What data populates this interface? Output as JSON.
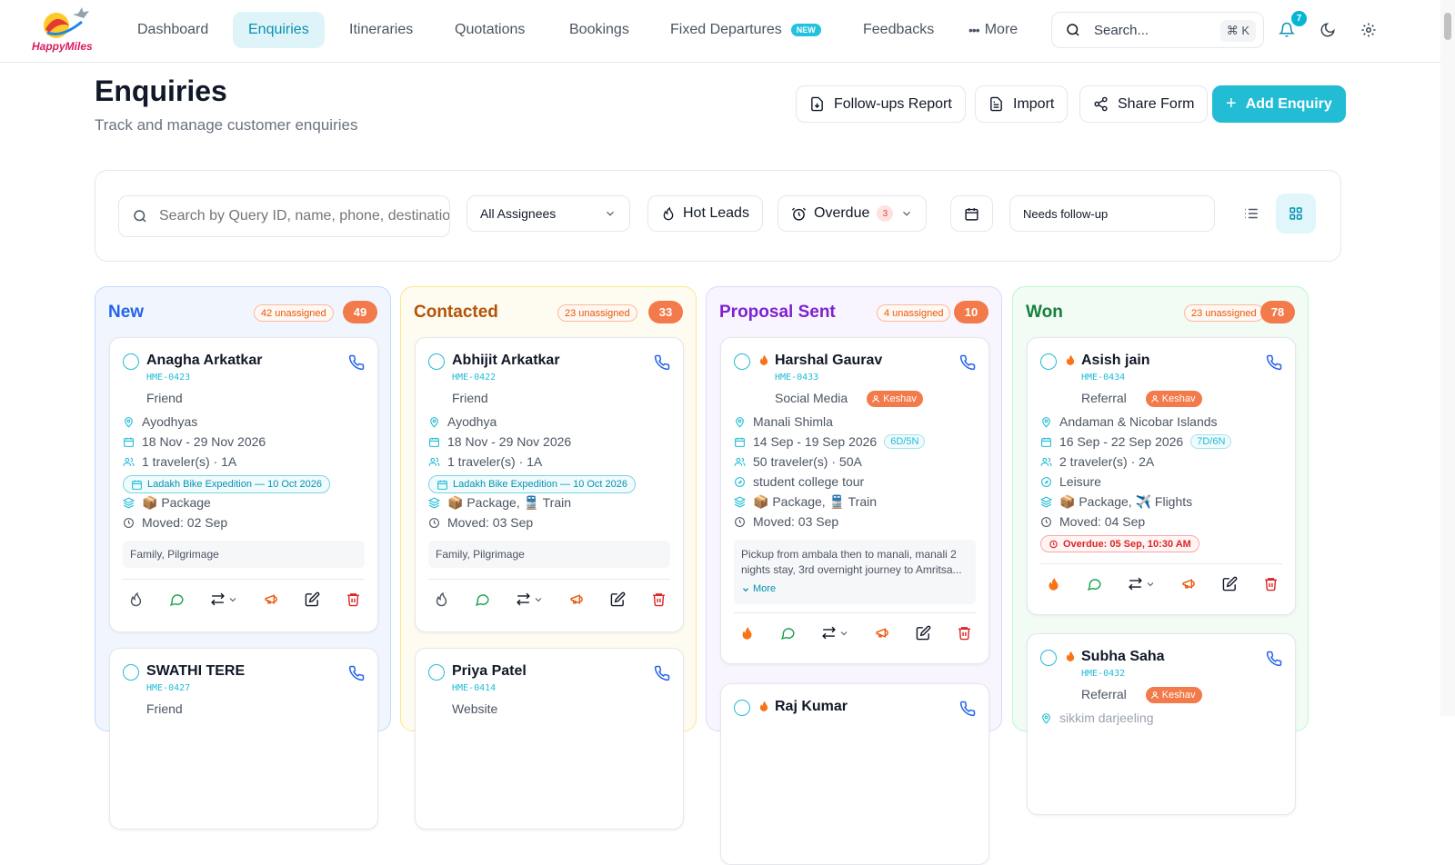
{
  "brand": {
    "name": "HappyMiles"
  },
  "nav": {
    "items": [
      {
        "label": "Dashboard"
      },
      {
        "label": "Enquiries",
        "active": true
      },
      {
        "label": "Itineraries"
      },
      {
        "label": "Quotations"
      },
      {
        "label": "Bookings"
      },
      {
        "label": "Fixed Departures",
        "badge": "NEW"
      },
      {
        "label": "Feedbacks"
      },
      {
        "label": "More"
      }
    ]
  },
  "search": {
    "label": "Search...",
    "shortcut": "⌘ K"
  },
  "notifications": {
    "count": "7"
  },
  "page": {
    "title": "Enquiries",
    "subtitle": "Track and manage customer enquiries"
  },
  "header_buttons": {
    "followups": "Follow-ups Report",
    "import": "Import",
    "share": "Share Form",
    "add": "Add Enquiry"
  },
  "filters": {
    "search_placeholder": "Search by Query ID, name, phone, destination",
    "assignees": "All Assignees",
    "hot_leads": "Hot Leads",
    "overdue": "Overdue",
    "overdue_count": "3",
    "followup": "Needs follow-up"
  },
  "colors": {
    "accent": "#22bcd5",
    "count": "#f27a4b",
    "hot": "#f97316"
  },
  "columns": [
    {
      "title": "New",
      "unassigned": "42 unassigned",
      "count": "49",
      "color": "#2563eb",
      "bg": "#f1f6fe",
      "border": "#bfdbfe",
      "cards": [
        {
          "name": "Anagha Arkatkar",
          "id": "HME-0423",
          "source": "Friend",
          "destination": "Ayodhyas",
          "dates": "18 Nov - 29 Nov 2026",
          "travelers": "1 traveler(s) · 1A",
          "fd": "Ladakh Bike Expedition — 10 Oct 2026",
          "services": "📦 Package",
          "moved": "Moved: 02 Sep",
          "notes": "Family, Pilgrimage"
        },
        {
          "name": "SWATHI TERE",
          "id": "HME-0427",
          "source": "Friend"
        }
      ]
    },
    {
      "title": "Contacted",
      "unassigned": "23 unassigned",
      "count": "33",
      "color": "#b45309",
      "bg": "#fefcf0",
      "border": "#fde68a",
      "cards": [
        {
          "name": "Abhijit Arkatkar",
          "id": "HME-0422",
          "source": "Friend",
          "destination": "Ayodhya",
          "dates": "18 Nov - 29 Nov 2026",
          "travelers": "1 traveler(s) · 1A",
          "fd": "Ladakh Bike Expedition — 10 Oct 2026",
          "services": "📦 Package,  🚆 Train",
          "moved": "Moved: 03 Sep",
          "notes": "Family, Pilgrimage"
        },
        {
          "name": "Priya Patel",
          "id": "HME-0414",
          "source": "Website"
        }
      ]
    },
    {
      "title": "Proposal Sent",
      "unassigned": "4 unassigned",
      "count": "10",
      "color": "#7e22ce",
      "bg": "#f8f5fe",
      "border": "#ddd6fe",
      "cards": [
        {
          "name": "Harshal Gaurav",
          "id": "HME-0433",
          "source": "Social Media",
          "assignee": "Keshav",
          "destination": "Manali Shimla",
          "dates": "14 Sep - 19 Sep 2026",
          "duration": "6D/5N",
          "travelers": "50 traveler(s) · 50A",
          "purpose": "student college tour",
          "services": "📦 Package,  🚆 Train",
          "moved": "Moved: 03 Sep",
          "notes": "Pickup from ambala then to manali, manali 2 nights stay, 3rd overnight journey to Amritsa...",
          "more": "More"
        },
        {
          "name": "Raj Kumar"
        }
      ]
    },
    {
      "title": "Won",
      "unassigned": "23 unassigned",
      "count": "78",
      "color": "#15803d",
      "bg": "#f2fbf4",
      "border": "#bbf7d0",
      "cards": [
        {
          "name": "Asish jain",
          "id": "HME-0434",
          "source": "Referral",
          "assignee": "Keshav",
          "destination": "Andaman & Nicobar Islands",
          "dates": "16 Sep - 22 Sep 2026",
          "duration": "7D/6N",
          "travelers": "2 traveler(s) · 2A",
          "purpose": "Leisure",
          "services": "📦 Package,  ✈️ Flights",
          "moved": "Moved: 04 Sep",
          "overdue": "Overdue: 05 Sep, 10:30 AM"
        },
        {
          "name": "Subha Saha",
          "id": "HME-0432",
          "source": "Referral",
          "assignee": "Keshav",
          "destination": "sikkim darjeeling"
        }
      ]
    }
  ]
}
